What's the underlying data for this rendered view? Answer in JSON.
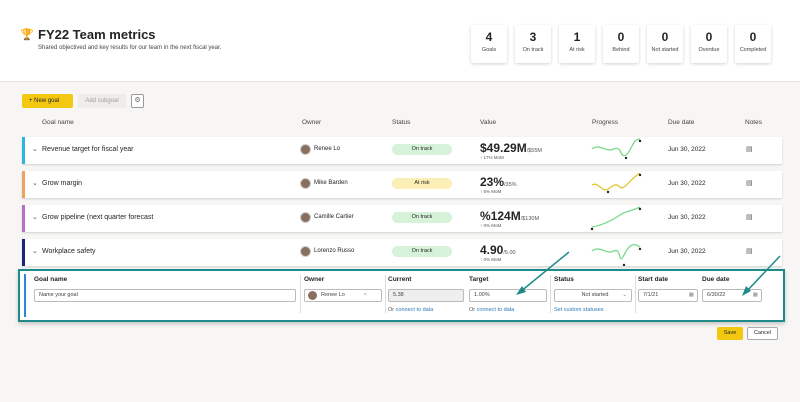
{
  "header": {
    "title": "FY22 Team metrics",
    "subtitle": "Shared objectived and key results for our team in the next fiscal year.",
    "icon": "trophy-icon"
  },
  "summary": [
    {
      "count": "4",
      "label": "Goals"
    },
    {
      "count": "3",
      "label": "On track"
    },
    {
      "count": "1",
      "label": "At risk"
    },
    {
      "count": "0",
      "label": "Behind"
    },
    {
      "count": "0",
      "label": "Not started"
    },
    {
      "count": "0",
      "label": "Overdue"
    },
    {
      "count": "0",
      "label": "Completed"
    }
  ],
  "toolbar": {
    "new_goal": "New goal",
    "add_subgoal": "Add subgoal"
  },
  "columns": [
    "Goal name",
    "Owner",
    "Status",
    "Value",
    "Progress",
    "Due date",
    "Notes"
  ],
  "goals": [
    {
      "name": "Revenue target for fiscal year",
      "owner": "Renee Lo",
      "status": "On track",
      "value": "$49.29M",
      "target": "/$55M",
      "change": "↑ 17% MoM",
      "due": "Jun 30, 2022",
      "color": "#2bb5e0"
    },
    {
      "name": "Grow margin",
      "owner": "Mike Barden",
      "status": "At risk",
      "value": "23%",
      "target": "/35%",
      "change": "↑ 5% MoM",
      "due": "Jun 30, 2022",
      "color": "#f0a35e"
    },
    {
      "name": "Grow pipeline (next quarter forecast",
      "owner": "Camille Cartier",
      "status": "On track",
      "value": "%124M",
      "target": "/$130M",
      "change": "↑ 0% MoM",
      "due": "Jun 30, 2022",
      "color": "#b86fc8"
    },
    {
      "name": "Workplace safety",
      "owner": "Lorenzo Russo",
      "status": "On track",
      "value": "4.90",
      "target": "/5.00",
      "change": "↑ 0% MoM",
      "due": "Jun 30, 2022",
      "color": "#1a237e"
    }
  ],
  "status_colors": {
    "On track": "#d6f2d9",
    "At risk": "#fbefb5"
  },
  "edit": {
    "goal_name_label": "Goal name",
    "goal_name_placeholder": "Name your goal",
    "owner_label": "Owner",
    "owner": "Renee Lo",
    "current_label": "Current",
    "current": "5.38",
    "target_label": "Target",
    "target": "1.00%",
    "connect_prefix": "Or",
    "connect": "connect to data",
    "status_label": "Status",
    "status": "Not started",
    "custom_statuses": "Set custom statuses",
    "start_label": "Start date",
    "start": "7/1/21",
    "due_label": "Due date",
    "due": "6/30/22"
  },
  "actions": {
    "save": "Save",
    "cancel": "Cancel"
  }
}
